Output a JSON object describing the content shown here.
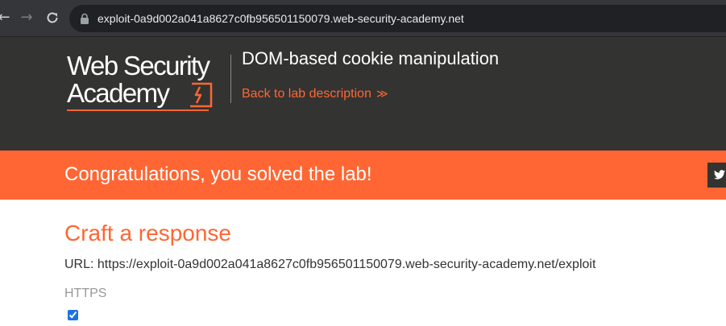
{
  "browser": {
    "url": "exploit-0a9d002a041a8627c0fb956501150079.web-security-academy.net",
    "icons": [
      "back-arrow-icon",
      "forward-arrow-icon",
      "reload-icon",
      "lock-icon"
    ]
  },
  "header": {
    "logo_line1": "Web Security",
    "logo_line2": "Academy",
    "lab_title": "DOM-based cookie manipulation",
    "back_link": "Back to lab description",
    "back_link_chevrons": "≫"
  },
  "banner": {
    "message": "Congratulations, you solved the lab!",
    "share_icon": "twitter-icon"
  },
  "main": {
    "title": "Craft a response",
    "url_line": "URL: https://exploit-0a9d002a041a8627c0fb956501150079.web-security-academy.net/exploit",
    "https_label": "HTTPS",
    "https_checked": true
  },
  "colors": {
    "accent": "#ff6633",
    "header_bg": "#333332",
    "chrome_bg": "#35363a"
  }
}
